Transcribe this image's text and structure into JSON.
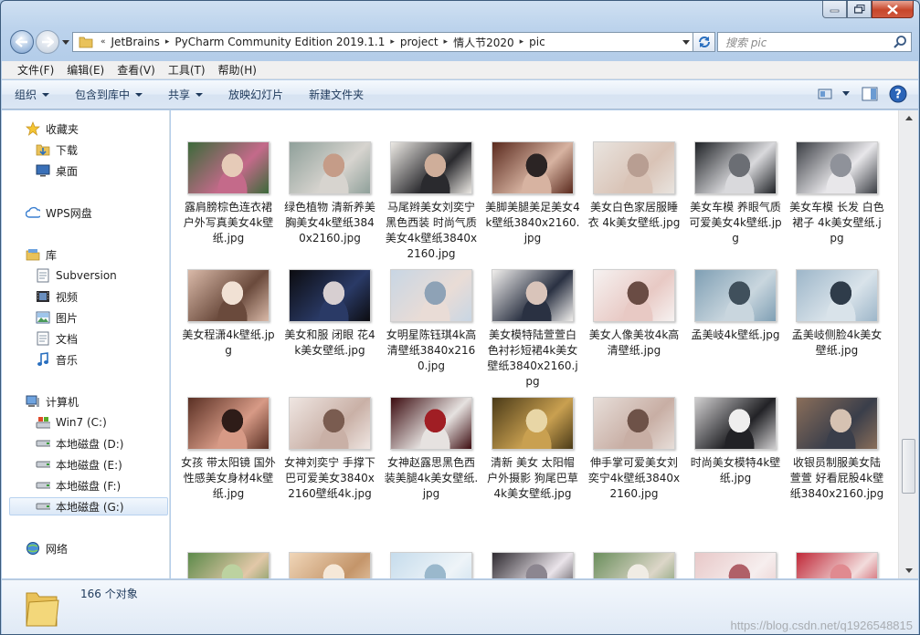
{
  "window": {
    "minimize": "minimize",
    "maximize": "maximize",
    "close": "close"
  },
  "address": {
    "overflow": "«",
    "crumbs": [
      "JetBrains",
      "PyCharm Community Edition 2019.1.1",
      "project",
      "情人节2020",
      "pic"
    ]
  },
  "search": {
    "placeholder": "搜索 pic"
  },
  "menu": [
    "文件(F)",
    "编辑(E)",
    "查看(V)",
    "工具(T)",
    "帮助(H)"
  ],
  "commands": {
    "organize": "组织",
    "include": "包含到库中",
    "share": "共享",
    "slideshow": "放映幻灯片",
    "newfolder": "新建文件夹"
  },
  "nav": {
    "favorites": "收藏夹",
    "downloads": "下载",
    "desktop": "桌面",
    "wps": "WPS网盘",
    "libraries": "库",
    "subversion": "Subversion",
    "videos": "视频",
    "pictures": "图片",
    "documents": "文档",
    "music": "音乐",
    "computer": "计算机",
    "drive_c": "Win7 (C:)",
    "drive_d": "本地磁盘 (D:)",
    "drive_e": "本地磁盘 (E:)",
    "drive_f": "本地磁盘 (F:)",
    "drive_g": "本地磁盘 (G:)",
    "network": "网络"
  },
  "files": [
    {
      "name": "露肩膀棕色连衣裙 户外写真美女4k壁纸.jpg",
      "colors": [
        "#3c6a3a",
        "#c46a8a",
        "#e6cbb8"
      ]
    },
    {
      "name": "绿色植物 清新养美胸美女4k壁纸3840x2160.jpg",
      "colors": [
        "#8fa09a",
        "#d7d4cf",
        "#c59c88"
      ]
    },
    {
      "name": "马尾辫美女刘奕宁 黑色西装 时尚气质美女4k壁纸3840x2160.jpg",
      "colors": [
        "#ece9e4",
        "#2a2a2e",
        "#cfae9a"
      ]
    },
    {
      "name": "美脚美腿美足美女4k壁纸3840x2160.jpg",
      "colors": [
        "#5a2a1e",
        "#d7b3a1",
        "#2b2424"
      ]
    },
    {
      "name": "美女白色家居服睡衣 4k美女壁纸.jpg",
      "colors": [
        "#e9e4df",
        "#d9c3b6",
        "#b89e92"
      ]
    },
    {
      "name": "美女车模 养眼气质可爱美女4k壁纸.jpg",
      "colors": [
        "#1f2226",
        "#d9d9dc",
        "#6b6e74"
      ]
    },
    {
      "name": "美女车模 长发 白色裙子 4k美女壁纸.jpg",
      "colors": [
        "#3b3e44",
        "#e8e7ea",
        "#8f929a"
      ]
    },
    {
      "name": "美女程潇4k壁纸.jpg",
      "colors": [
        "#d9b9a8",
        "#6a4a3c",
        "#f1e1d4"
      ]
    },
    {
      "name": "美女和服 闭眼 花4k美女壁纸.jpg",
      "colors": [
        "#0c0c10",
        "#2a3a66",
        "#d7cfd1"
      ]
    },
    {
      "name": "女明星陈钰琪4k高清壁纸3840x2160.jpg",
      "colors": [
        "#c8d6e4",
        "#e9dcd6",
        "#8ea2b6"
      ]
    },
    {
      "name": "美女模特陆萱萱白色衬衫短裙4k美女壁纸3840x2160.jpg",
      "colors": [
        "#f1efed",
        "#2a3142",
        "#d9c4ba"
      ]
    },
    {
      "name": "美女人像美妆4k高清壁纸.jpg",
      "colors": [
        "#f6f2f1",
        "#e8c9c4",
        "#6a4c44"
      ]
    },
    {
      "name": "孟美岐4k壁纸.jpg",
      "colors": [
        "#7f9fb4",
        "#c9d6de",
        "#40505c"
      ]
    },
    {
      "name": "孟美岐侧脸4k美女壁纸.jpg",
      "colors": [
        "#9db6c9",
        "#d9e3ea",
        "#2f3c4a"
      ]
    },
    {
      "name": "女孩 带太阳镜 国外性感美女身材4k壁纸.jpg",
      "colors": [
        "#5a3024",
        "#d79a86",
        "#2e1c18"
      ]
    },
    {
      "name": "女神刘奕宁 手撑下巴可爱美女3840x2160壁纸4k.jpg",
      "colors": [
        "#efe6e2",
        "#c9b0a6",
        "#7a5c50"
      ]
    },
    {
      "name": "女神赵露思黑色西装美腿4k美女壁纸.jpg",
      "colors": [
        "#3c0c10",
        "#e6e2e0",
        "#a01e24"
      ]
    },
    {
      "name": "清新 美女 太阳帽 户外摄影 狗尾巴草 4k美女壁纸.jpg",
      "colors": [
        "#4a3a18",
        "#c9a050",
        "#e8d6a6"
      ]
    },
    {
      "name": "伸手掌可爱美女刘奕宁4k壁纸3840x2160.jpg",
      "colors": [
        "#e7ded9",
        "#c8aea4",
        "#6e5248"
      ]
    },
    {
      "name": "时尚美女模特4k壁纸.jpg",
      "colors": [
        "#d0cfd0",
        "#222226",
        "#efeeee"
      ]
    },
    {
      "name": "收银员制服美女陆萱萱 好看屁股4k壁纸3840x2160.jpg",
      "colors": [
        "#8a6e5a",
        "#3a3e4a",
        "#d6c2b2"
      ]
    },
    {
      "name": "",
      "colors": [
        "#5c8a4a",
        "#e2c8a8",
        "#bcd2a0"
      ]
    },
    {
      "name": "",
      "colors": [
        "#f0d6b8",
        "#c4956a",
        "#f6e8d8"
      ]
    },
    {
      "name": "",
      "colors": [
        "#c6dcec",
        "#eef4f8",
        "#9ab8cc"
      ]
    },
    {
      "name": "",
      "colors": [
        "#2e2a30",
        "#eae4ea",
        "#8c8690"
      ]
    },
    {
      "name": "",
      "colors": [
        "#6a8e5c",
        "#dcd6c8",
        "#f0ece4"
      ]
    },
    {
      "name": "",
      "colors": [
        "#e8c8c8",
        "#f6eeee",
        "#b06068"
      ]
    },
    {
      "name": "",
      "colors": [
        "#c02838",
        "#f2dcdc",
        "#e08a90"
      ]
    }
  ],
  "status": {
    "count": "166 个对象"
  },
  "watermark": "https://blog.csdn.net/q1926548815"
}
